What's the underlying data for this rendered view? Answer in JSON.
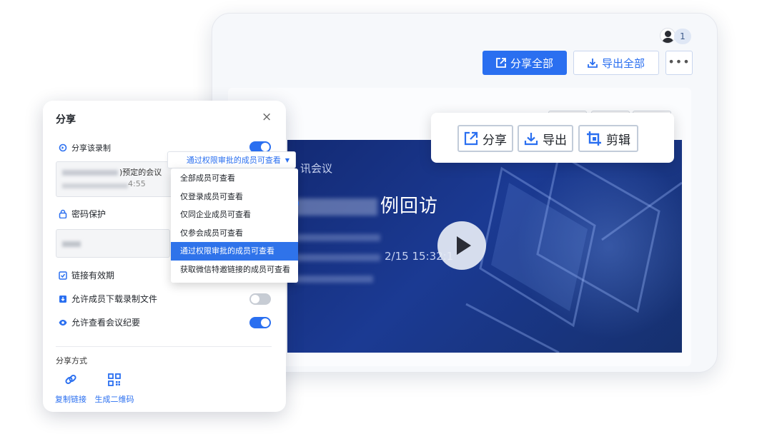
{
  "main_window": {
    "participant_count": "1",
    "share_all_label": "分享全部",
    "export_all_label": "导出全部",
    "more_label": "•••"
  },
  "video": {
    "meeting_label": "讯会议",
    "title_suffix": "例回访",
    "time_text": "2/15 15:32:1"
  },
  "floating_toolbar": {
    "share_label": "分享",
    "export_label": "导出",
    "clip_label": "剪辑"
  },
  "share_dialog": {
    "title": "分享",
    "close_glyph": "×",
    "share_recording_label": "分享该录制",
    "meeting_name_tail": ")预定的会议",
    "meeting_time_tail": "4:55",
    "password_label": "密码保护",
    "link_validity_label": "链接有效期",
    "allow_download_label": "允许成员下载录制文件",
    "allow_summary_label": "允许查看会议纪要",
    "share_method_label": "分享方式",
    "copy_link_label": "复制链接",
    "qr_code_label": "生成二维码",
    "toggles": {
      "share_recording": true,
      "allow_download": false,
      "allow_summary": true
    }
  },
  "permission_dropdown": {
    "selected": "通过权限审批的成员可查看",
    "options": [
      "全部成员可查看",
      "仅登录成员可查看",
      "仅同企业成员可查看",
      "仅参会成员可查看",
      "通过权限审批的成员可查看",
      "获取微信特邀链接的成员可查看"
    ],
    "selected_index": 4
  },
  "colors": {
    "accent": "#2a6ff0",
    "video_bg": "#1b3a93",
    "toggle_off": "#c7ccd4"
  }
}
